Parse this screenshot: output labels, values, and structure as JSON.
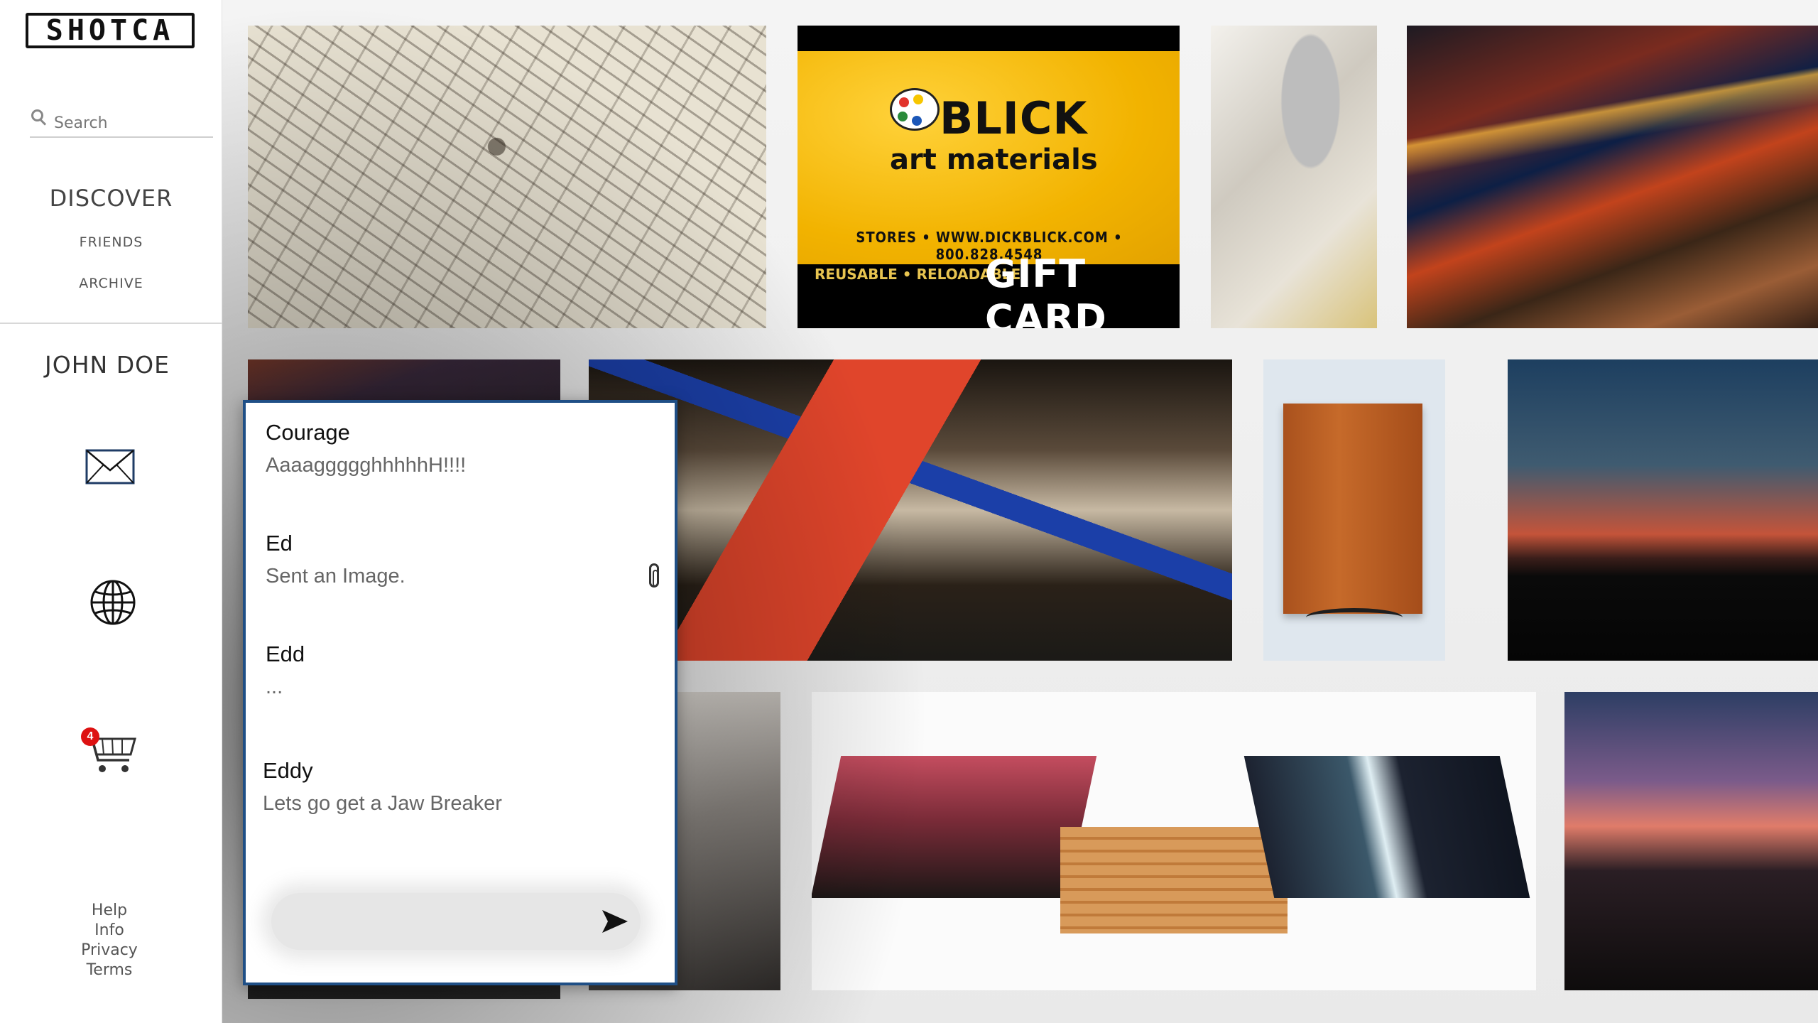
{
  "app": {
    "logo_text": "SHOTCA"
  },
  "search": {
    "placeholder": "Search"
  },
  "nav": {
    "discover": "DISCOVER",
    "friends": "FRIENDS",
    "archive": "ARCHIVE"
  },
  "user": {
    "name": "JOHN DOE"
  },
  "icons": {
    "mail": "mail-icon",
    "globe": "globe-icon",
    "cart": "cart-icon"
  },
  "cart": {
    "badge_count": "4"
  },
  "footer": {
    "help": "Help",
    "info": "Info",
    "privacy": "Privacy",
    "terms": "Terms"
  },
  "gift_card": {
    "brand": "BLICK",
    "brand_sub": "art materials",
    "stores_line": "STORES • WWW.DICKBLICK.COM • 800.828.4548",
    "reusable": "REUSABLE • RELOADABLE",
    "title": "GIFT CARD"
  },
  "messages": [
    {
      "name": "Courage",
      "text": "AaaaggggghhhhhH!!!!"
    },
    {
      "name": "Ed",
      "text": "Sent an Image."
    },
    {
      "name": "Edd",
      "text": "..."
    },
    {
      "name": "Eddy",
      "text": "Lets go get a Jaw Breaker"
    }
  ],
  "colors": {
    "panel_border": "#1f4f86",
    "badge": "#dd1111"
  }
}
